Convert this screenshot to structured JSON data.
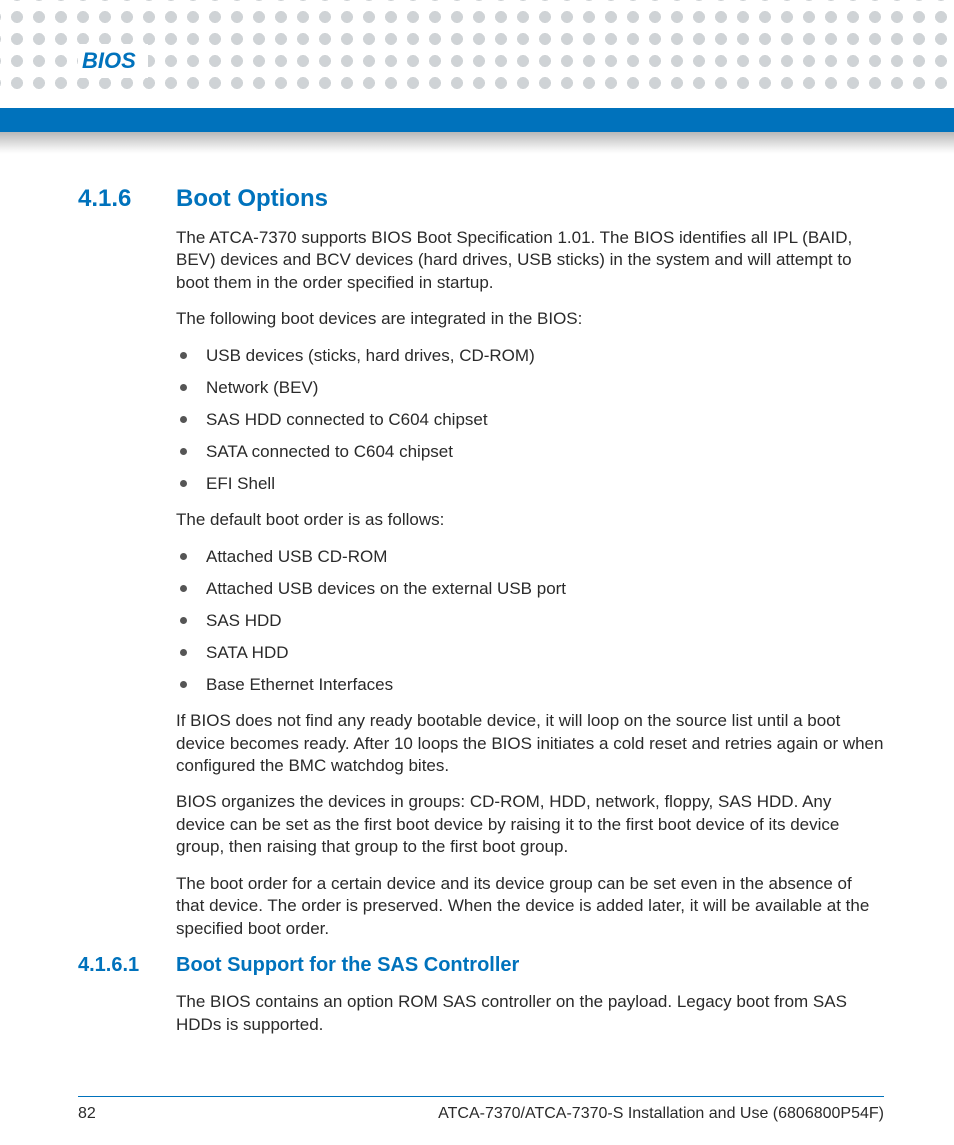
{
  "header": {
    "label": "BIOS"
  },
  "section": {
    "number": "4.1.6",
    "title": "Boot Options",
    "para1": "The ATCA-7370 supports BIOS Boot Specification 1.01. The BIOS identifies all IPL (BAID, BEV) devices and BCV devices (hard drives, USB sticks) in the system and will attempt to boot them in the order specified in startup.",
    "para2": "The following boot devices are integrated in the BIOS:",
    "list1": [
      "USB devices (sticks, hard drives, CD-ROM)",
      "Network (BEV)",
      "SAS HDD connected to C604 chipset",
      "SATA connected to C604 chipset",
      "EFI Shell"
    ],
    "para3": "The default boot order is as follows:",
    "list2": [
      "Attached USB CD-ROM",
      "Attached USB devices on the external USB port",
      "SAS HDD",
      "SATA HDD",
      "Base Ethernet Interfaces"
    ],
    "para4": "If BIOS does not find any ready bootable device, it will loop on the source list until a boot device becomes ready. After 10 loops the BIOS initiates a cold reset and retries again or when configured the BMC watchdog bites.",
    "para5": "BIOS organizes the devices in groups: CD-ROM, HDD, network, floppy, SAS HDD. Any device can be set as the first boot device by raising it to the first boot device of its device group, then raising that group to the first boot group.",
    "para6": "The boot order for a certain device and its device group can be set even in the absence of that device. The order is preserved. When the device is added later, it will be available at the specified boot order."
  },
  "subsection": {
    "number": "4.1.6.1",
    "title": "Boot Support for the SAS Controller",
    "para1": "The BIOS contains an option ROM SAS controller on the payload. Legacy boot from SAS HDDs is supported."
  },
  "footer": {
    "page": "82",
    "docref": "ATCA-7370/ATCA-7370-S Installation and Use (6806800P54F)"
  }
}
